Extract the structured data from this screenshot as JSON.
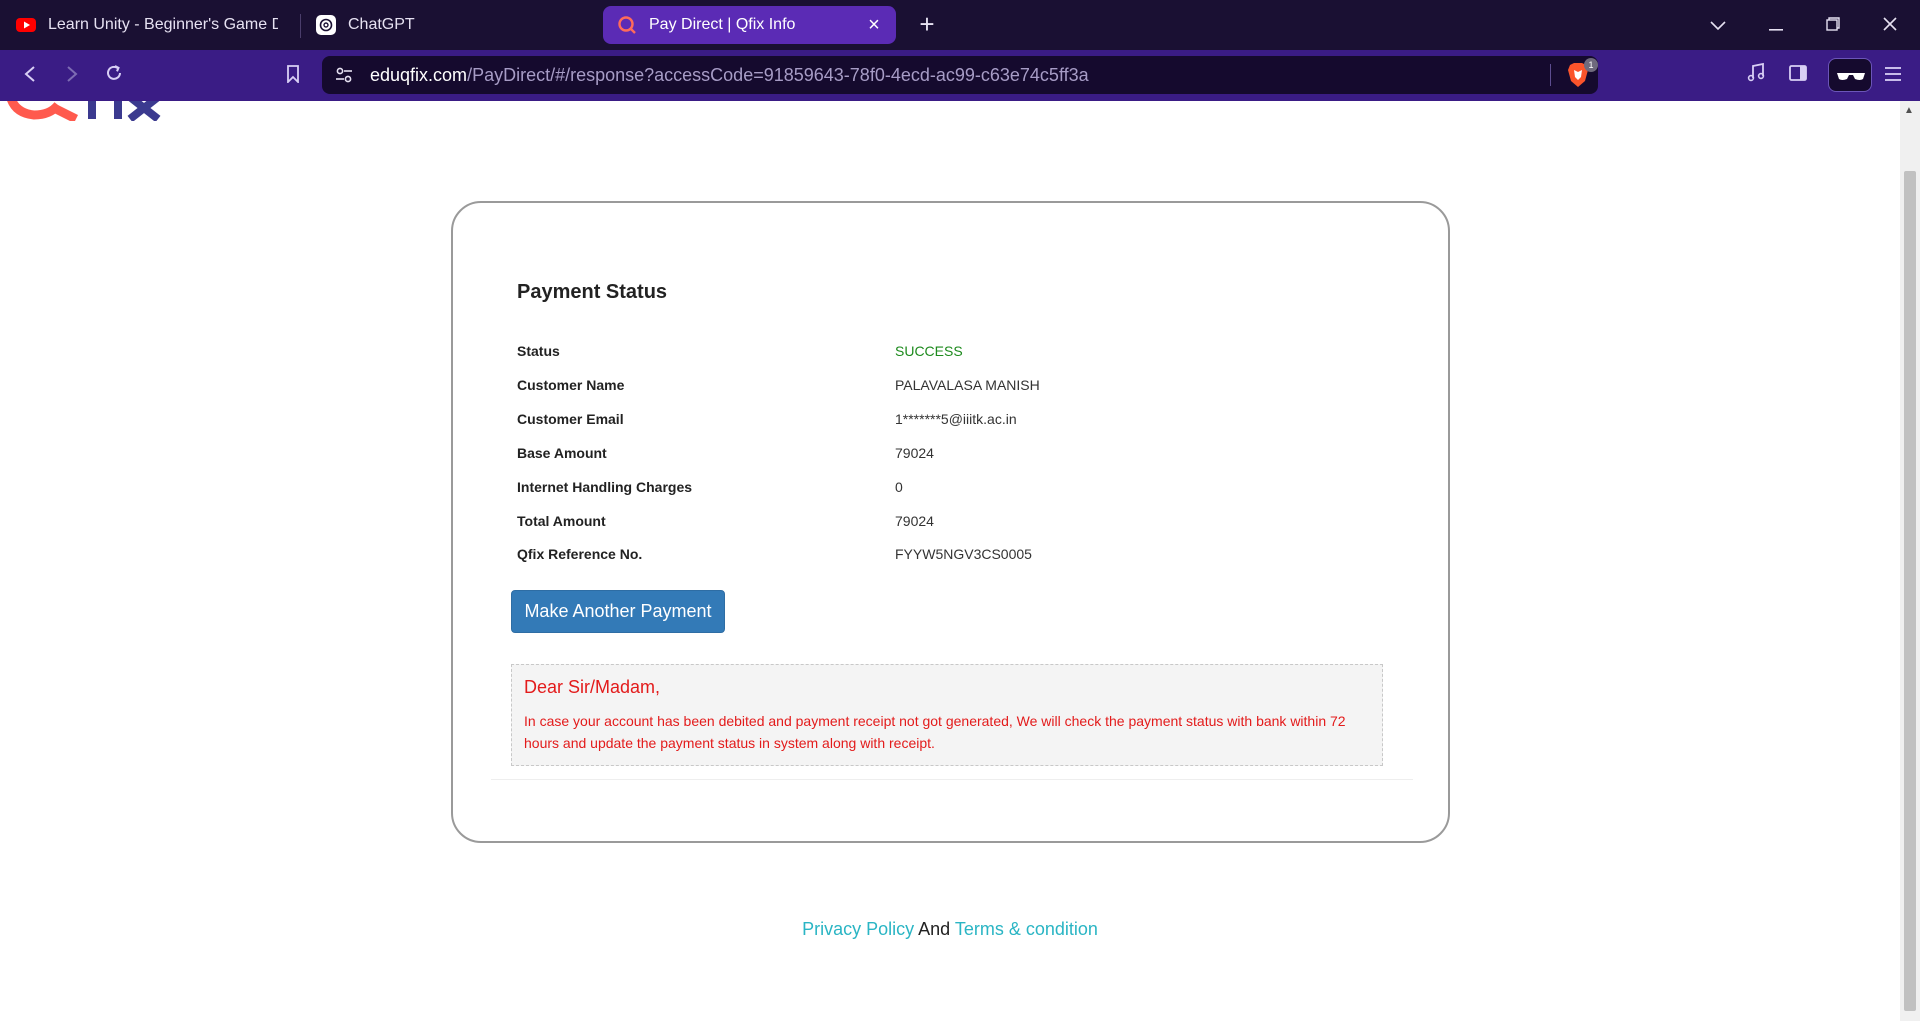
{
  "browser": {
    "tabs": [
      {
        "title": "Learn Unity - Beginner's Game Deve",
        "icon": "youtube-icon",
        "active": false
      },
      {
        "title": "ChatGPT",
        "icon": "chatgpt-icon",
        "active": false
      },
      {
        "title": "Pay Direct | Qfix Info",
        "icon": "qfix-icon",
        "active": true
      }
    ],
    "url_domain": "eduqfix.com",
    "url_path": "/PayDirect/#/response?accessCode=91859643-78f0-4ecd-ac99-c63e74c5ff3a",
    "shields_count": "1"
  },
  "payment": {
    "title": "Payment Status",
    "rows": [
      {
        "label": "Status",
        "value": "SUCCESS"
      },
      {
        "label": "Customer Name",
        "value": "PALAVALASA MANISH"
      },
      {
        "label": "Customer Email",
        "value": "1*******5@iiitk.ac.in"
      },
      {
        "label": "Base Amount",
        "value": "79024"
      },
      {
        "label": "Internet Handling Charges",
        "value": "0"
      },
      {
        "label": "Total Amount",
        "value": "79024"
      },
      {
        "label": "Qfix Reference No.",
        "value": "FYYW5NGV3CS0005"
      }
    ],
    "button_label": "Make Another Payment",
    "notice_heading": "Dear Sir/Madam,",
    "notice_body": "In case your account has been debited and payment receipt not got generated, We will check the payment status with bank within 72 hours and update the payment status in system along with receipt."
  },
  "footer": {
    "privacy": "Privacy Policy",
    "and": "And",
    "terms": "Terms & condition"
  },
  "colors": {
    "success": "#1d8a1d",
    "notice_text": "#e31b1b",
    "button": "#337ab7",
    "link": "#2ab5c4",
    "tab_active": "#5b2bb5"
  }
}
